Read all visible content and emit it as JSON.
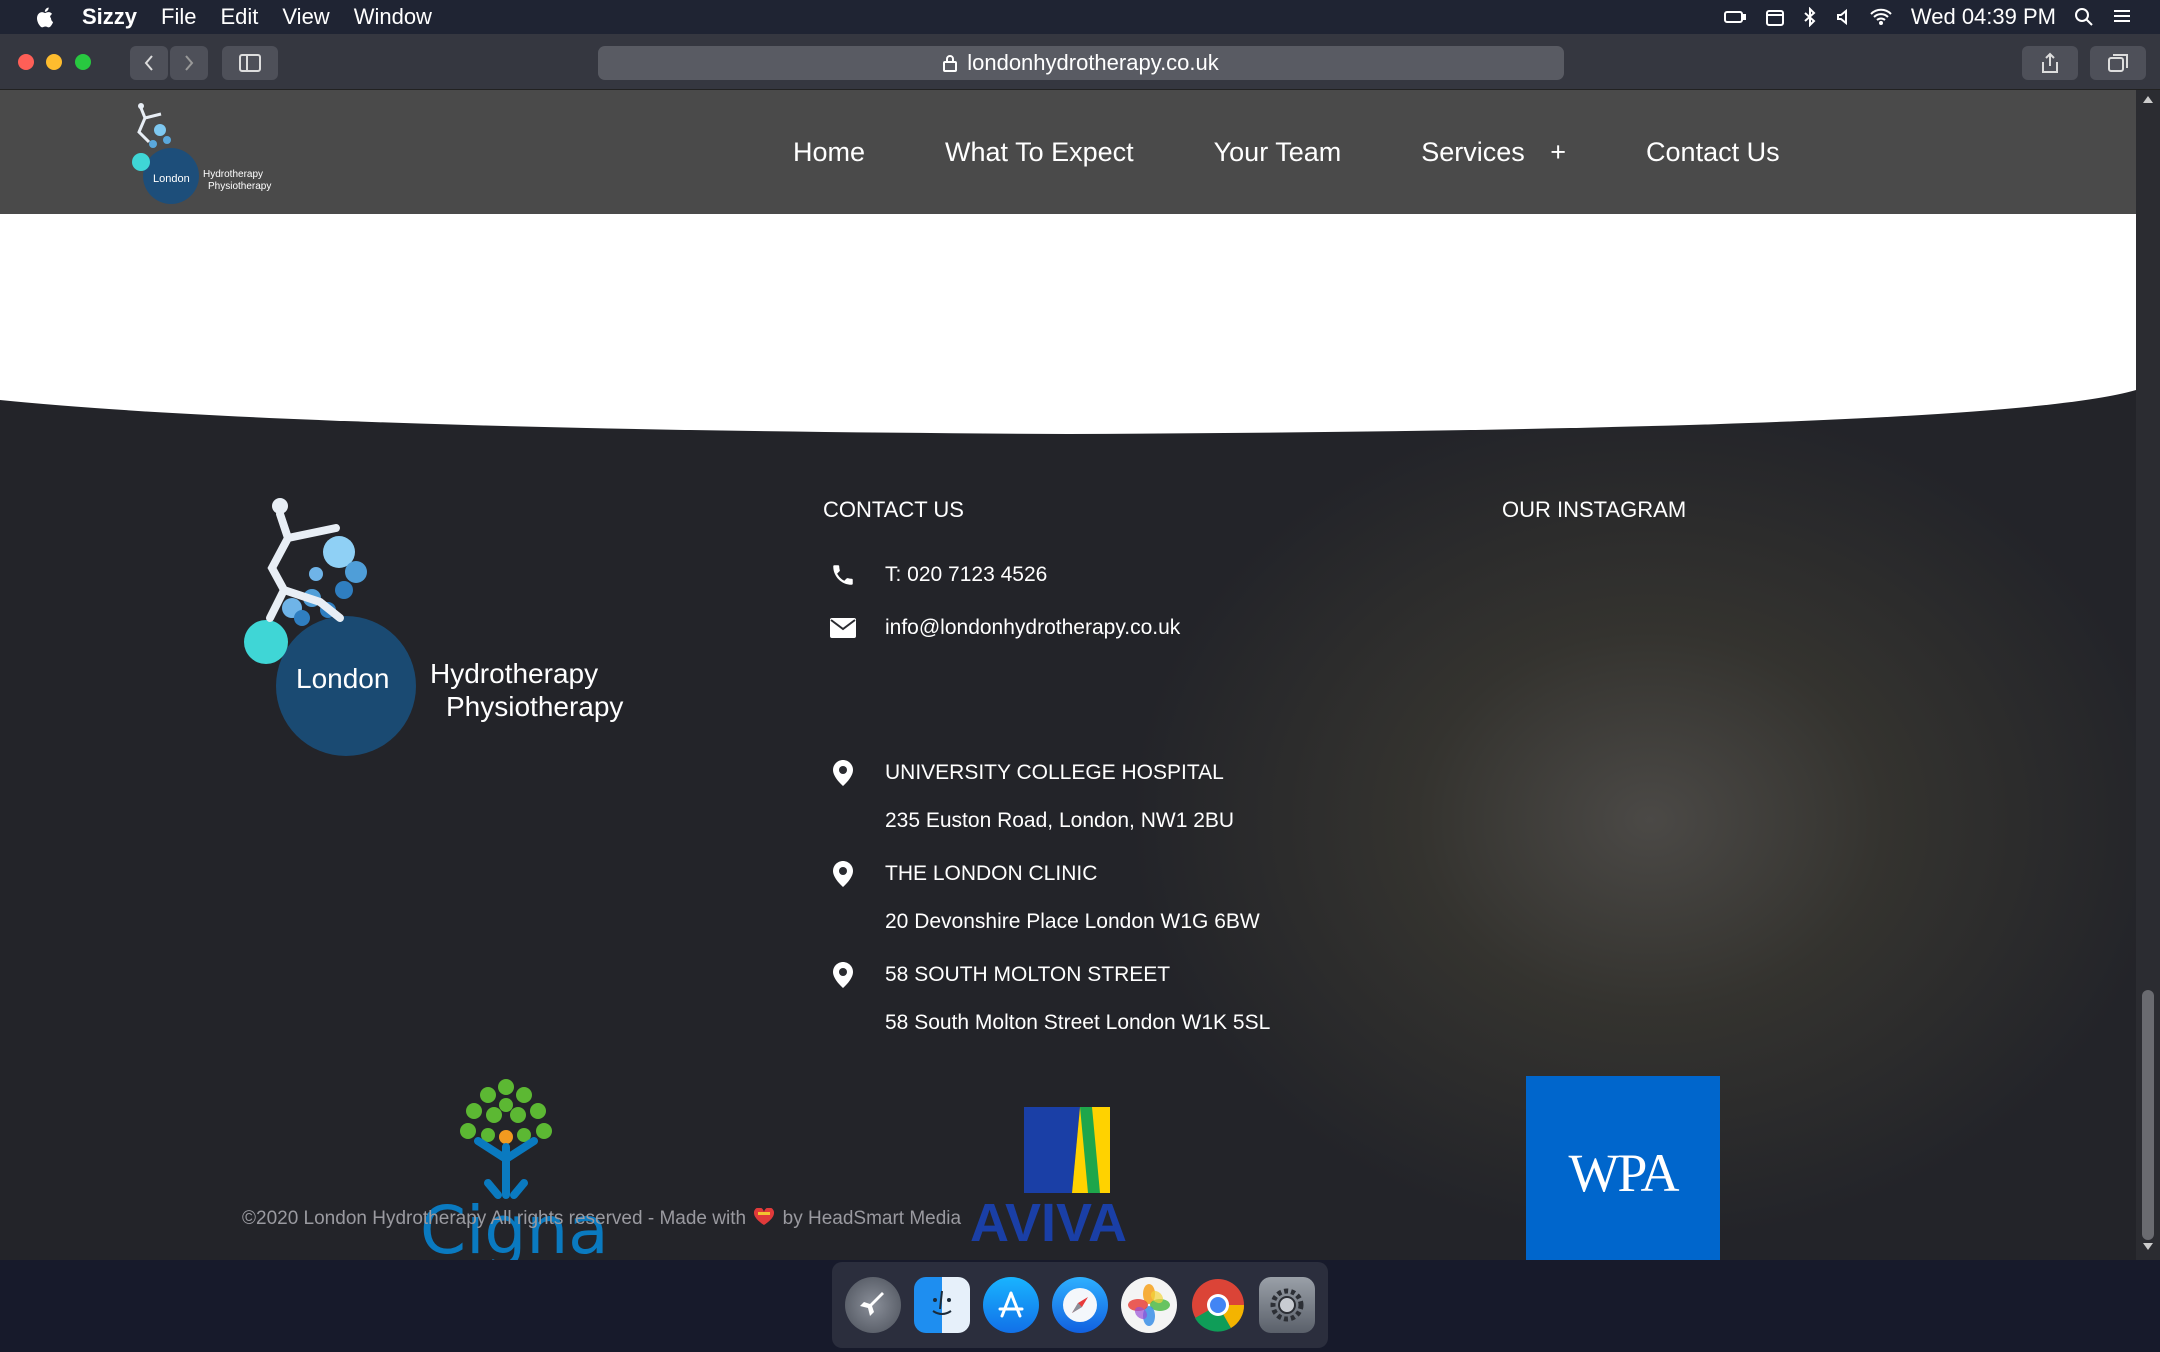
{
  "menubar": {
    "app": "Sizzy",
    "items": [
      "File",
      "Edit",
      "View",
      "Window"
    ],
    "clock": "Wed 04:39 PM"
  },
  "browser": {
    "url": "londonhydrotherapy.co.uk"
  },
  "site": {
    "logo": {
      "line1": "London",
      "line2": "Hydrotherapy",
      "line3": "Physiotherapy"
    },
    "nav": [
      {
        "label": "Home"
      },
      {
        "label": "What To Expect"
      },
      {
        "label": "Your Team"
      },
      {
        "label": "Services",
        "suffix": "+"
      },
      {
        "label": "Contact Us"
      }
    ]
  },
  "footer": {
    "logo": {
      "line1": "London",
      "line2": "Hydrotherapy",
      "line3": "Physiotherapy"
    },
    "contact_title": "CONTACT US",
    "instagram_title": "OUR INSTAGRAM",
    "phone": "T: 020 7123 4526",
    "email": "info@londonhydrotherapy.co.uk",
    "locations": [
      {
        "name": "UNIVERSITY COLLEGE HOSPITAL",
        "address": "235 Euston Road, London, NW1 2BU"
      },
      {
        "name": "THE LONDON CLINIC",
        "address": "20 Devonshire Place London W1G 6BW"
      },
      {
        "name": "58 SOUTH MOLTON STREET",
        "address": "58 South Molton Street London W1K 5SL"
      }
    ],
    "insurers": {
      "cigna": "Cigna",
      "aviva": "AVIVA",
      "wpa": "WPA"
    },
    "copyright_pre": "©2020 London Hydrotherapy All rights reserved - Made with",
    "copyright_post": "by HeadSmart Media"
  },
  "colors": {
    "header_bg": "#4a4a4a",
    "logo_blue": "#1d4e7a",
    "logo_teal": "#3fd6d6",
    "wpa_blue": "#0066cc",
    "cigna_blue": "#0a7ac0",
    "aviva_blue": "#1a3fa6"
  },
  "dock": [
    "launchpad-icon",
    "finder-icon",
    "app-store-icon",
    "safari-icon",
    "photos-icon",
    "chrome-icon",
    "system-preferences-icon"
  ]
}
